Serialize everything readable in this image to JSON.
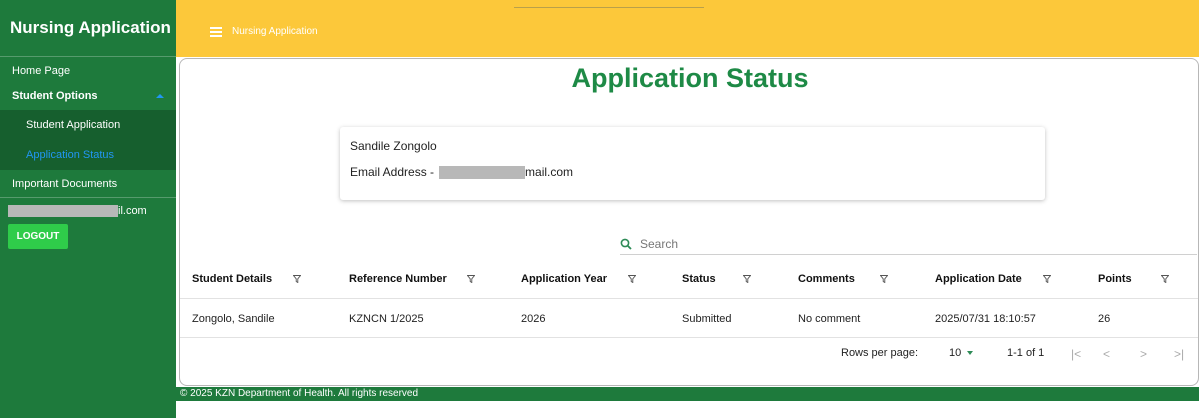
{
  "sidebar": {
    "brand": "Nursing Application",
    "home": "Home Page",
    "student_options": "Student Options",
    "student_application": "Student Application",
    "application_status": "Application Status",
    "important_documents": "Important Documents",
    "user_email_suffix": "il.com",
    "logout": "LOGOUT"
  },
  "header": {
    "title": "Nursing Application"
  },
  "main": {
    "title": "Application Status",
    "student_name": "Sandile Zongolo",
    "email_label": "Email Address -",
    "email_suffix": "mail.com",
    "search_placeholder": "Search"
  },
  "table": {
    "columns": [
      "Student Details",
      "Reference Number",
      "Application Year",
      "Status",
      "Comments",
      "Application Date",
      "Points"
    ],
    "rows": [
      [
        "Zongolo, Sandile",
        "KZNCN 1/2025",
        "2026",
        "Submitted",
        "No comment",
        "2025/07/31 18:10:57",
        "26"
      ]
    ]
  },
  "pagination": {
    "rows_per_page_label": "Rows per page:",
    "rows_per_page_value": "10",
    "range": "1-1 of 1"
  },
  "footer": {
    "text": "© 2025 KZN Department of Health. All rights reserved"
  },
  "colors": {
    "sidebar": "#1e7a3c",
    "header": "#fcc83a",
    "accent": "#1e8a46",
    "logout": "#2fcc4a",
    "active_link": "#2196f3"
  }
}
